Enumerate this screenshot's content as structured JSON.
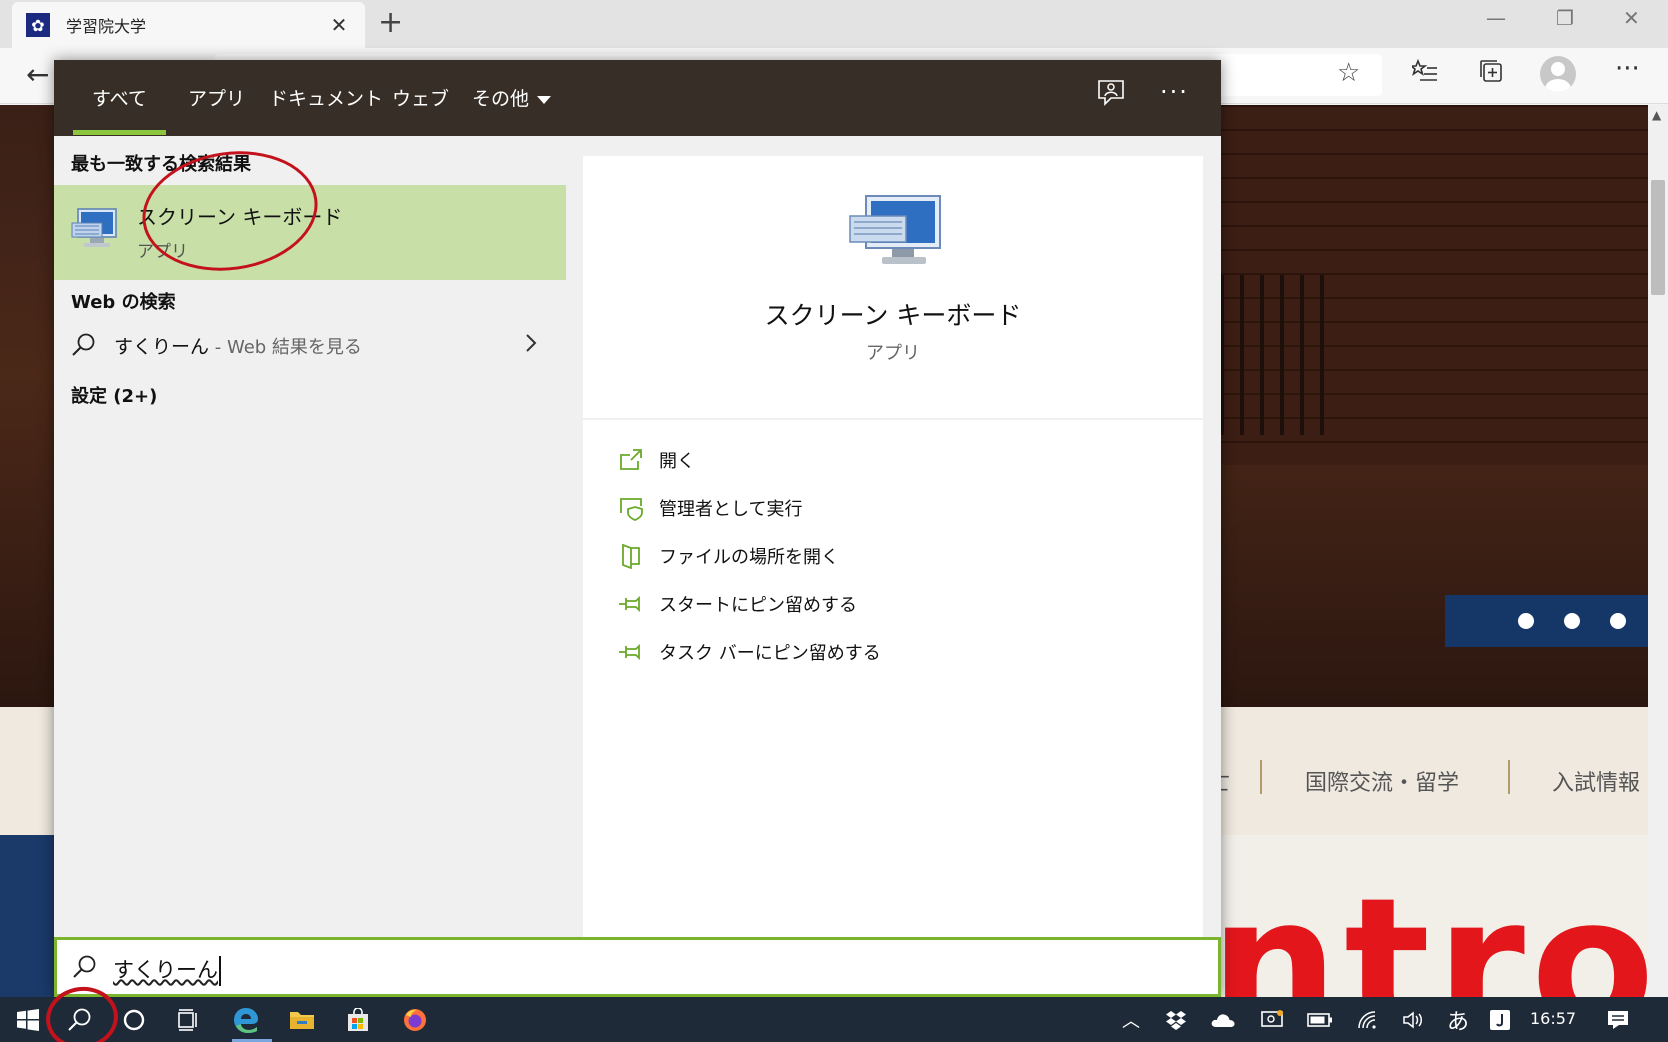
{
  "browser": {
    "tab_title": "学習院大学",
    "tab_favicon": "✿",
    "new_tab_label": "+",
    "close_tab_label": "✕"
  },
  "page": {
    "nav_items": [
      "国際交流・留学",
      "入試情報"
    ],
    "nav_partial": "亡",
    "hero_text": "ntrol",
    "carousel_dots": 3
  },
  "search": {
    "filters": [
      {
        "label": "すべて",
        "active": true
      },
      {
        "label": "アプリ",
        "active": false
      },
      {
        "label": "ドキュメント",
        "active": false
      },
      {
        "label": "ウェブ",
        "active": false
      },
      {
        "label": "その他",
        "active": false,
        "has_dropdown": true
      }
    ],
    "more_label": "···",
    "best_match_heading": "最も一致する検索結果",
    "best_match": {
      "title": "スクリーン キーボード",
      "subtitle": "アプリ",
      "icon": "on-screen-keyboard-icon"
    },
    "web_heading": "Web の検索",
    "web_result": {
      "query": "すくりーん",
      "suffix": " - Web 結果を見る"
    },
    "settings_heading": "設定 (2+)",
    "detail": {
      "title": "スクリーン キーボード",
      "subtitle": "アプリ",
      "actions": [
        {
          "label": "開く",
          "icon": "open-icon"
        },
        {
          "label": "管理者として実行",
          "icon": "run-as-admin-icon"
        },
        {
          "label": "ファイルの場所を開く",
          "icon": "file-location-icon"
        },
        {
          "label": "スタートにピン留めする",
          "icon": "pin-icon"
        },
        {
          "label": "タスク バーにピン留めする",
          "icon": "pin-icon"
        }
      ]
    },
    "input_value": "すくりーん"
  },
  "taskbar": {
    "clock": "16:57",
    "ime_label": "あ",
    "accent": "#8cc63f"
  }
}
